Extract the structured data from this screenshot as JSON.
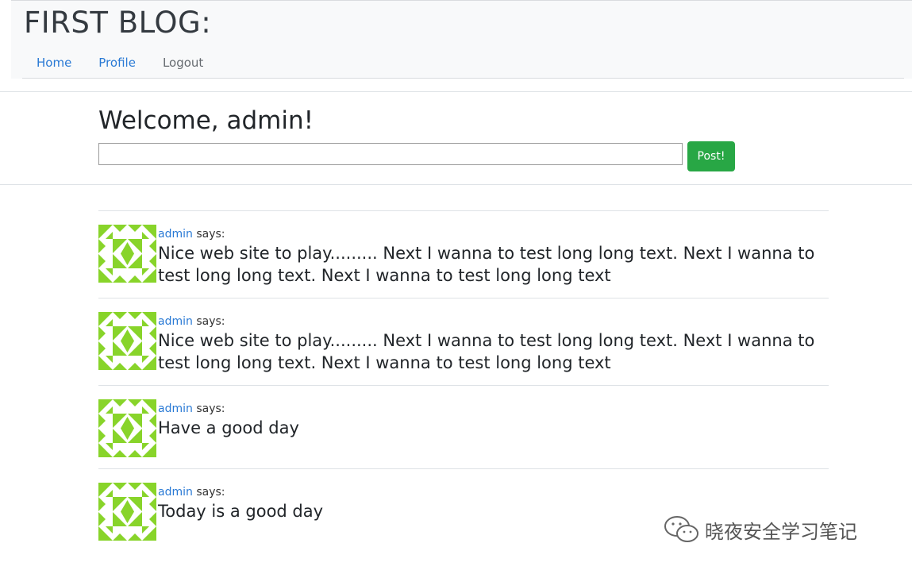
{
  "header": {
    "site_title": "FIRST BLOG:",
    "nav": [
      {
        "label": "Home"
      },
      {
        "label": "Profile"
      },
      {
        "label": "Logout"
      }
    ]
  },
  "composer": {
    "welcome": "Welcome, admin!",
    "input_value": "",
    "post_button": "Post!"
  },
  "posts": [
    {
      "author": "admin",
      "says": " says:",
      "text": "Nice web site to play......... Next I wanna to test long long text. Next I wanna to test long long text. Next I wanna to test long long text"
    },
    {
      "author": "admin",
      "says": " says:",
      "text": "Nice web site to play......... Next I wanna to test long long text. Next I wanna to test long long text. Next I wanna to test long long text"
    },
    {
      "author": "admin",
      "says": " says:",
      "text": "Have a good day"
    },
    {
      "author": "admin",
      "says": " says:",
      "text": "Today is a good day"
    }
  ],
  "watermark": {
    "text": "晓夜安全学习笔记",
    "icon": "wechat-icon"
  },
  "colors": {
    "link": "#2a7ad5",
    "button": "#28a745",
    "avatar": "#88d42a"
  }
}
